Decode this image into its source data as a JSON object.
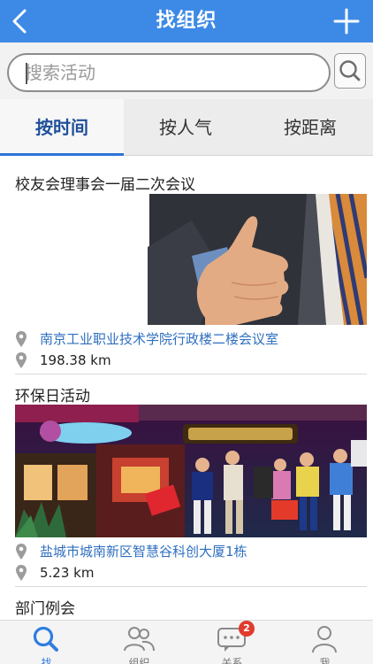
{
  "header": {
    "title": "找组织",
    "back_icon": "chevron-left-icon",
    "add_icon": "plus-icon",
    "bg_color": "#3d8ae6"
  },
  "search": {
    "placeholder": "搜索活动",
    "button_icon": "search-icon"
  },
  "tabs": [
    {
      "label": "按时间",
      "active": true
    },
    {
      "label": "按人气",
      "active": false
    },
    {
      "label": "按距离",
      "active": false
    }
  ],
  "activities": [
    {
      "title": "校友会理事会一届二次会议",
      "image": "handshake-photo",
      "location": "南京工业职业技术学院行政楼二楼会议室",
      "distance": "198.38 km"
    },
    {
      "title": "环保日活动",
      "image": "shopping-plaza-photo",
      "location": "盐城市城南新区智慧谷科创大厦1栋",
      "distance": "5.23 km"
    },
    {
      "title": "部门例会"
    }
  ],
  "bottom_nav": [
    {
      "label": "找",
      "icon": "search-icon",
      "active": true
    },
    {
      "label": "组织",
      "icon": "group-icon",
      "active": false
    },
    {
      "label": "关系",
      "icon": "chat-icon",
      "active": false,
      "badge": "2"
    },
    {
      "label": "我",
      "icon": "person-icon",
      "active": false
    }
  ],
  "colors": {
    "accent": "#2f7de0",
    "link": "#2f6fc0",
    "badge": "#e03b2e"
  }
}
